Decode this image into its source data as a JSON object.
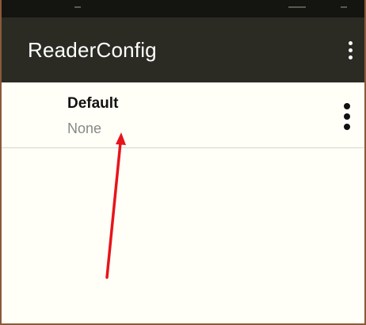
{
  "app_bar": {
    "title": "ReaderConfig",
    "menu_icon": "more-vert-icon"
  },
  "list": {
    "items": [
      {
        "title": "Default",
        "subtitle": "None",
        "menu_icon": "more-vert-icon"
      }
    ]
  },
  "colors": {
    "app_bar_background": "#2b2b24",
    "status_strip": "#141410",
    "list_background": "#fffff8",
    "annotation_arrow": "#e8141b"
  },
  "annotation": {
    "type": "arrow",
    "color": "#e8141b",
    "icon": "arrow-annotation-icon"
  }
}
